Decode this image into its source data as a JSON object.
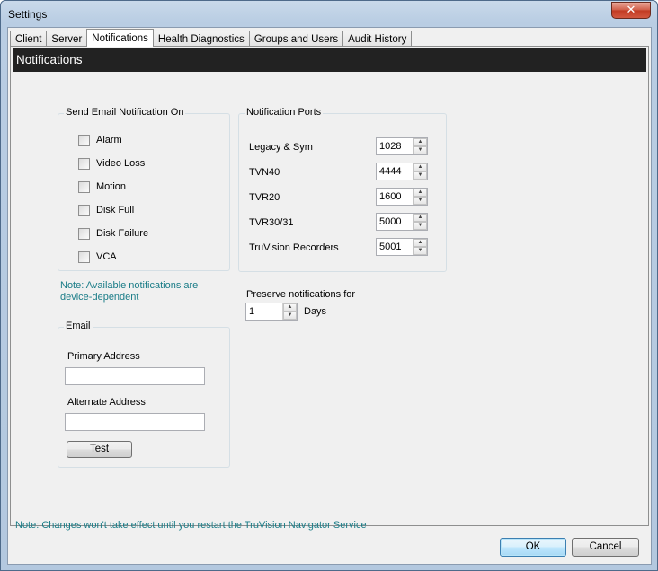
{
  "window": {
    "title": "Settings",
    "close_glyph": "✕"
  },
  "tabs": [
    {
      "label": "Client"
    },
    {
      "label": "Server"
    },
    {
      "label": "Notifications",
      "active": true
    },
    {
      "label": "Health Diagnostics"
    },
    {
      "label": "Groups and Users"
    },
    {
      "label": "Audit History"
    }
  ],
  "header": {
    "title": "Notifications"
  },
  "email_notifications": {
    "title": "Send Email Notification On",
    "items": [
      {
        "label": "Alarm",
        "checked": false
      },
      {
        "label": "Video Loss",
        "checked": false
      },
      {
        "label": "Motion",
        "checked": false
      },
      {
        "label": "Disk Full",
        "checked": false
      },
      {
        "label": "Disk Failure",
        "checked": false
      },
      {
        "label": "VCA",
        "checked": false
      }
    ],
    "note_line1": "Note: Available notifications are",
    "note_line2": "device-dependent"
  },
  "email": {
    "title": "Email",
    "primary_label": "Primary Address",
    "primary_value": "",
    "alternate_label": "Alternate Address",
    "alternate_value": "",
    "test_button": "Test"
  },
  "ports": {
    "title": "Notification Ports",
    "items": [
      {
        "label": "Legacy & Sym",
        "value": "1028"
      },
      {
        "label": "TVN40",
        "value": "4444"
      },
      {
        "label": "TVR20",
        "value": "1600"
      },
      {
        "label": "TVR30/31",
        "value": "5000"
      },
      {
        "label": "TruVision Recorders",
        "value": "5001"
      }
    ]
  },
  "preserve": {
    "label": "Preserve notifications for",
    "value": "1",
    "unit": "Days"
  },
  "footer_note": "Note: Changes won't take effect until you restart the TruVision Navigator Service",
  "buttons": {
    "ok": "OK",
    "cancel": "Cancel"
  },
  "spin_up_glyph": "▲",
  "spin_down_glyph": "▼"
}
